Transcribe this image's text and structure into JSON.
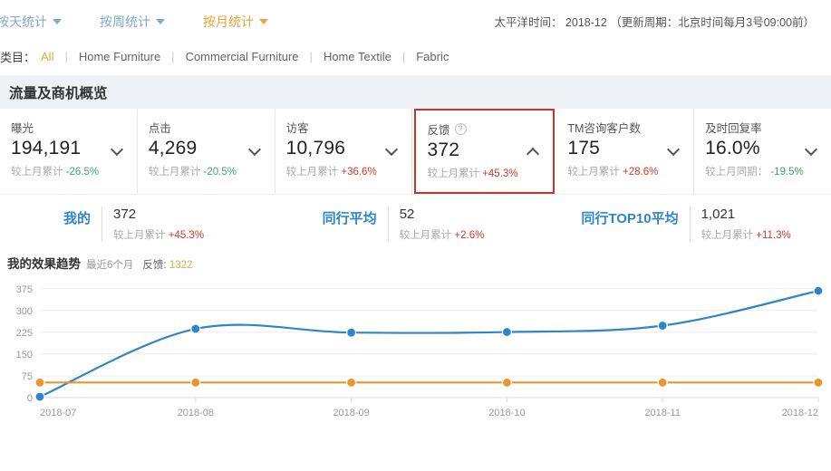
{
  "topbar": {
    "tabs": [
      {
        "label": "按天统计",
        "active": false
      },
      {
        "label": "按周统计",
        "active": false
      },
      {
        "label": "按月统计",
        "active": true
      }
    ],
    "time_info": "太平洋时间： 2018-12 （更新周期：北京时间每月3号09:00前）"
  },
  "category_filter": {
    "label": "类目：",
    "items": [
      {
        "label": "All",
        "active": true
      },
      {
        "label": "Home Furniture",
        "active": false
      },
      {
        "label": "Commercial Furniture",
        "active": false
      },
      {
        "label": "Home Textile",
        "active": false
      },
      {
        "label": "Fabric",
        "active": false
      }
    ],
    "separator": "|"
  },
  "section": {
    "title": "流量及商机概览"
  },
  "cards": [
    {
      "title": "曝光",
      "value": "194,191",
      "delta_label": "较上月累计",
      "delta_value": "-26.5%",
      "delta_sign": "neg",
      "chevron": "down",
      "selected": false,
      "help": false
    },
    {
      "title": "点击",
      "value": "4,269",
      "delta_label": "较上月累计",
      "delta_value": "-20.5%",
      "delta_sign": "neg",
      "chevron": "down",
      "selected": false,
      "help": false
    },
    {
      "title": "访客",
      "value": "10,796",
      "delta_label": "较上月累计",
      "delta_value": "+36.6%",
      "delta_sign": "pos",
      "chevron": "down",
      "selected": false,
      "help": false
    },
    {
      "title": "反馈",
      "value": "372",
      "delta_label": "较上月累计",
      "delta_value": "+45.3%",
      "delta_sign": "pos",
      "chevron": "up",
      "selected": true,
      "help": true,
      "help_glyph": "?"
    },
    {
      "title": "TM咨询客户数",
      "value": "175",
      "delta_label": "较上月累计",
      "delta_value": "+28.6%",
      "delta_sign": "pos",
      "chevron": "down",
      "selected": false,
      "help": false
    },
    {
      "title": "及时回复率",
      "value": "16.0%",
      "delta_label": "较上月同期：",
      "delta_value": "-19.5%",
      "delta_sign": "neg",
      "chevron": "down",
      "selected": false,
      "help": false
    }
  ],
  "compare": [
    {
      "name": "我的",
      "value": "372",
      "delta_label": "较上月累计",
      "delta_value": "+45.3%"
    },
    {
      "name": "同行平均",
      "value": "52",
      "delta_label": "较上月累计",
      "delta_value": "+2.6%"
    },
    {
      "name": "同行TOP10平均",
      "value": "1,021",
      "delta_label": "较上月累计",
      "delta_value": "+11.3%"
    }
  ],
  "chart_data": {
    "type": "line",
    "title": "我的效果趋势",
    "subtitle": "最近6个月",
    "metric_label": "反馈:",
    "metric_value": "1322",
    "categories": [
      "2018-07",
      "2018-08",
      "2018-09",
      "2018-10",
      "2018-11",
      "2018-12"
    ],
    "series": [
      {
        "name": "我的",
        "color": "#2e86c8",
        "values": [
          3,
          237,
          224,
          226,
          248,
          368
        ]
      },
      {
        "name": "同行平均",
        "color": "#e8962e",
        "values": [
          52,
          52,
          52,
          52,
          52,
          52
        ]
      }
    ],
    "yticks": [
      0,
      75,
      150,
      225,
      300,
      375
    ],
    "ylim": [
      0,
      390
    ],
    "xlabel": "",
    "ylabel": "",
    "grid": true,
    "legend": "none",
    "smooth": true
  },
  "colors": {
    "accent_blue": "#2e86c8",
    "accent_orange": "#e8962e",
    "active_tab": "#e8a33d",
    "selected_border": "#c0392b",
    "positive": "#d0392b",
    "negative": "#4a9c6d"
  }
}
